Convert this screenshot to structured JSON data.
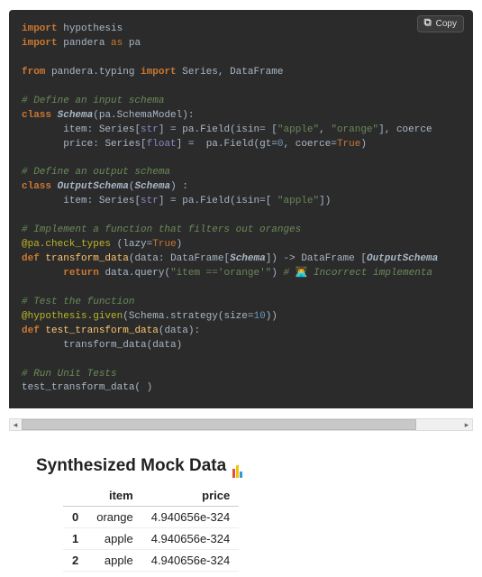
{
  "copy_button": {
    "label": "Copy"
  },
  "code": {
    "l1_import": "import",
    "l1_mod": "hypothesis",
    "l2_import": "import",
    "l2_mod": "pandera",
    "l2_as": "as",
    "l2_alias": "pa",
    "l3_from": "from",
    "l3_pkg": "pandera.typing",
    "l3_import": "import",
    "l3_names": "Series, DataFrame",
    "c_input": "# Define an input schema",
    "l_class": "class",
    "cls_Schema": "Schema",
    "base_Schema": "pa.SchemaModel",
    "item": "item",
    "Series": "Series",
    "str": "str",
    "paField": "pa.Field",
    "isin": "isin",
    "apple": "\"apple\"",
    "orange": "\"orange\"",
    "coerce_tail": ", coerce",
    "price": "price",
    "float": "float",
    "gt": "gt",
    "zero": "0",
    "coerce": "coerce",
    "True": "True",
    "c_output": "# Define an output schema",
    "cls_Output": "OutputSchema",
    "base_Output": "Schema",
    "apple2": "\"apple\"",
    "c_impl": "# Implement a function that filters out oranges",
    "dec_check": "@pa.check_types",
    "lazy": "lazy",
    "def": "def",
    "fn_transform": "transform_data",
    "data": "data",
    "DataFrame": "DataFrame",
    "arrow": "->",
    "OutputSchema": "OutputSchema",
    "return": "return",
    "query": "data.query",
    "qstr": "\"item =='orange'\"",
    "c_wrong": "#",
    "emoji": "👨‍💻",
    "c_wrong_txt": "Incorrect implementa",
    "c_test": "# Test the function",
    "dec_hyp": "@hypothesis.given",
    "strategy": "Schema.strategy",
    "size": "size",
    "ten": "10",
    "fn_test": "test_transform_data",
    "call_transform": "transform_data(data)",
    "c_run": "# Run Unit Tests",
    "run_call": "test_transform_data( )"
  },
  "heading": "Synthesized Mock Data",
  "table": {
    "headers": {
      "idx": "",
      "item": "item",
      "price": "price"
    },
    "rows": [
      {
        "idx": "0",
        "item": "orange",
        "price": "4.940656e-324"
      },
      {
        "idx": "1",
        "item": "apple",
        "price": "4.940656e-324"
      },
      {
        "idx": "2",
        "item": "apple",
        "price": "4.940656e-324"
      }
    ]
  },
  "chart_data": {
    "type": "table",
    "title": "Synthesized Mock Data",
    "columns": [
      "item",
      "price"
    ],
    "rows": [
      [
        "orange",
        5e-324
      ],
      [
        "apple",
        5e-324
      ],
      [
        "apple",
        5e-324
      ]
    ]
  }
}
